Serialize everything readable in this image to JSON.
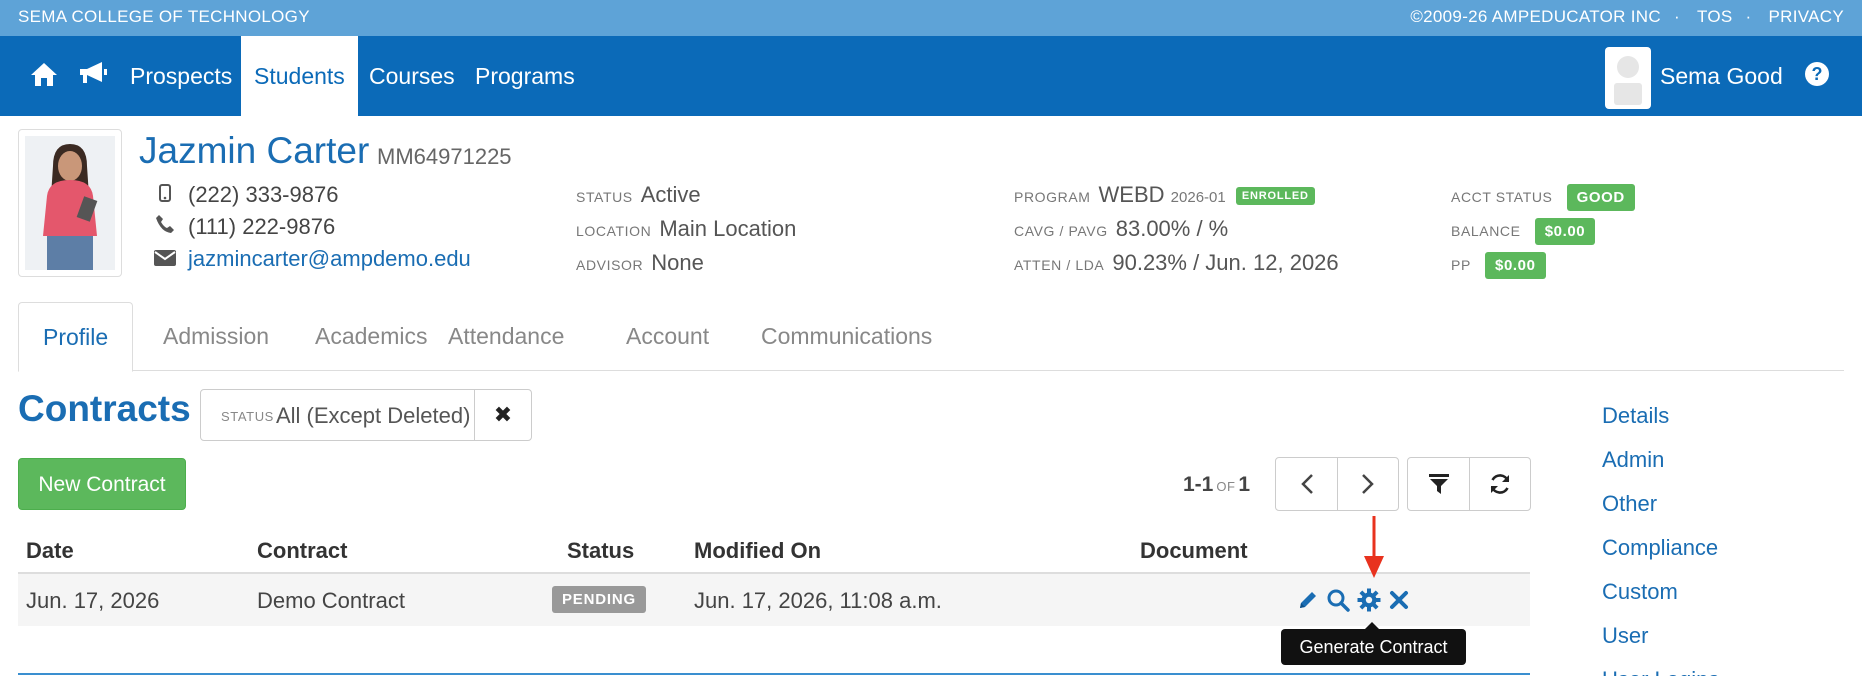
{
  "topbar": {
    "school": "SEMA COLLEGE OF TECHNOLOGY",
    "copyright": "©2009-26 AMPEDUCATOR INC",
    "tos": "TOS",
    "privacy": "PRIVACY",
    "separator": "·"
  },
  "nav": {
    "items": [
      "Prospects",
      "Students",
      "Courses",
      "Programs"
    ],
    "active": "Students",
    "user_name": "Sema Good",
    "help": "?"
  },
  "student": {
    "name": "Jazmin Carter",
    "id": "MM64971225",
    "mobile": "(222) 333-9876",
    "phone": "(111) 222-9876",
    "email": "jazmincarter@ampdemo.edu",
    "status_label": "STATUS",
    "status": "Active",
    "location_label": "LOCATION",
    "location": "Main Location",
    "advisor_label": "ADVISOR",
    "advisor": "None",
    "program_label": "PROGRAM",
    "program": "WEBD",
    "program_term": "2026-01",
    "program_badge": "ENROLLED",
    "cavg_label": "CAVG / PAVG",
    "cavg": "83.00% / %",
    "atten_label": "ATTEN / LDA",
    "atten": "90.23% / Jun. 12, 2026",
    "acct_label": "ACCT STATUS",
    "acct_status": "GOOD",
    "balance_label": "BALANCE",
    "balance": "$0.00",
    "pp_label": "PP",
    "pp": "$0.00"
  },
  "tabs": [
    "Profile",
    "Admission",
    "Academics",
    "Attendance",
    "Account",
    "Communications"
  ],
  "contracts": {
    "title": "Contracts",
    "filter_label": "STATUS",
    "filter_value": "All (Except Deleted)",
    "clear": "✖",
    "new_button": "New Contract",
    "pager_range": "1-1",
    "pager_of": "OF",
    "pager_total": "1",
    "columns": [
      "Date",
      "Contract",
      "Status",
      "Modified On",
      "Document"
    ],
    "rows": [
      {
        "date": "Jun. 17, 2026",
        "contract": "Demo Contract",
        "status": "PENDING",
        "modified": "Jun. 17, 2026, 11:08 a.m."
      }
    ],
    "tooltip": "Generate Contract"
  },
  "sidenav": [
    "Details",
    "Admin",
    "Other",
    "Compliance",
    "Custom",
    "User",
    "User Logins"
  ],
  "colors": {
    "topstrip": "#5ea3d7",
    "navbar": "#0b6ab8",
    "link": "#1a6db3",
    "success": "#5cb85c",
    "pending": "#999999",
    "annotation_arrow": "#e8321e"
  }
}
